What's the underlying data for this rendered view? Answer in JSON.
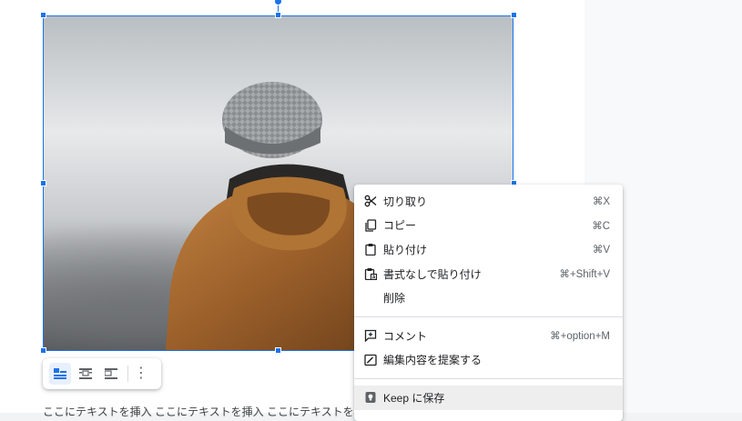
{
  "image_toolbar": {
    "options": [
      "inline",
      "wrap-text",
      "break-text"
    ],
    "more_icon": "⋮"
  },
  "document": {
    "body_text": "ここにテキストを挿入 ここにテキストを挿入 ここにテキストを挿入"
  },
  "context_menu": {
    "group1": [
      {
        "icon": "scissors-icon",
        "label": "切り取り",
        "shortcut": "⌘X"
      },
      {
        "icon": "copy-icon",
        "label": "コピー",
        "shortcut": "⌘C"
      },
      {
        "icon": "clipboard-icon",
        "label": "貼り付け",
        "shortcut": "⌘V"
      },
      {
        "icon": "paste-plain-icon",
        "label": "書式なしで貼り付け",
        "shortcut": "⌘+Shift+V"
      },
      {
        "icon": "",
        "label": "削除",
        "shortcut": ""
      }
    ],
    "group2": [
      {
        "icon": "comment-add-icon",
        "label": "コメント",
        "shortcut": "⌘+option+M"
      },
      {
        "icon": "suggest-edit-icon",
        "label": "編集内容を提案する",
        "shortcut": ""
      }
    ],
    "group3": [
      {
        "icon": "keep-icon",
        "label": "Keep に保存",
        "shortcut": ""
      }
    ]
  },
  "colors": {
    "selection": "#1a73e8",
    "keep_yellow": "#fbbc04"
  }
}
